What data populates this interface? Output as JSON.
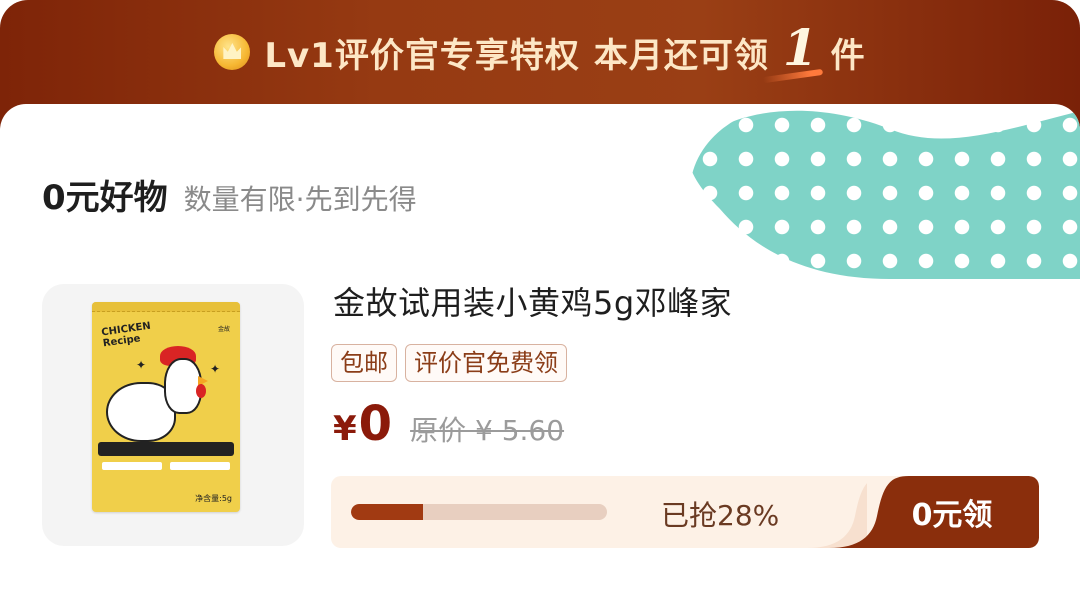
{
  "header": {
    "level_text": "Lv1评价官专享特权",
    "monthly_text": "本月还可领",
    "count": "1",
    "unit": "件",
    "crown_icon": "crown-icon"
  },
  "section": {
    "title": "0元好物",
    "subtitle": "数量有限·先到先得"
  },
  "product": {
    "name": "金故试用装小黄鸡5g邓峰家",
    "tags": [
      "包邮",
      "评价官免费领"
    ],
    "price_currency": "¥",
    "price": "0",
    "original_price": "原价 ¥ 5.60",
    "progress": 0.28,
    "progress_text": "已抢28%",
    "claim_label": "0元领",
    "package_labels": {
      "brand": "CHICKEN Recipe",
      "logo": "金故",
      "net": "净含量:5g"
    }
  },
  "colors": {
    "header_bg": "#963a12",
    "accent_dark": "#8a2e0c",
    "price": "#8b1a0a",
    "dots_bg": "#7fd3c7",
    "progress_fill": "#a13a12"
  }
}
